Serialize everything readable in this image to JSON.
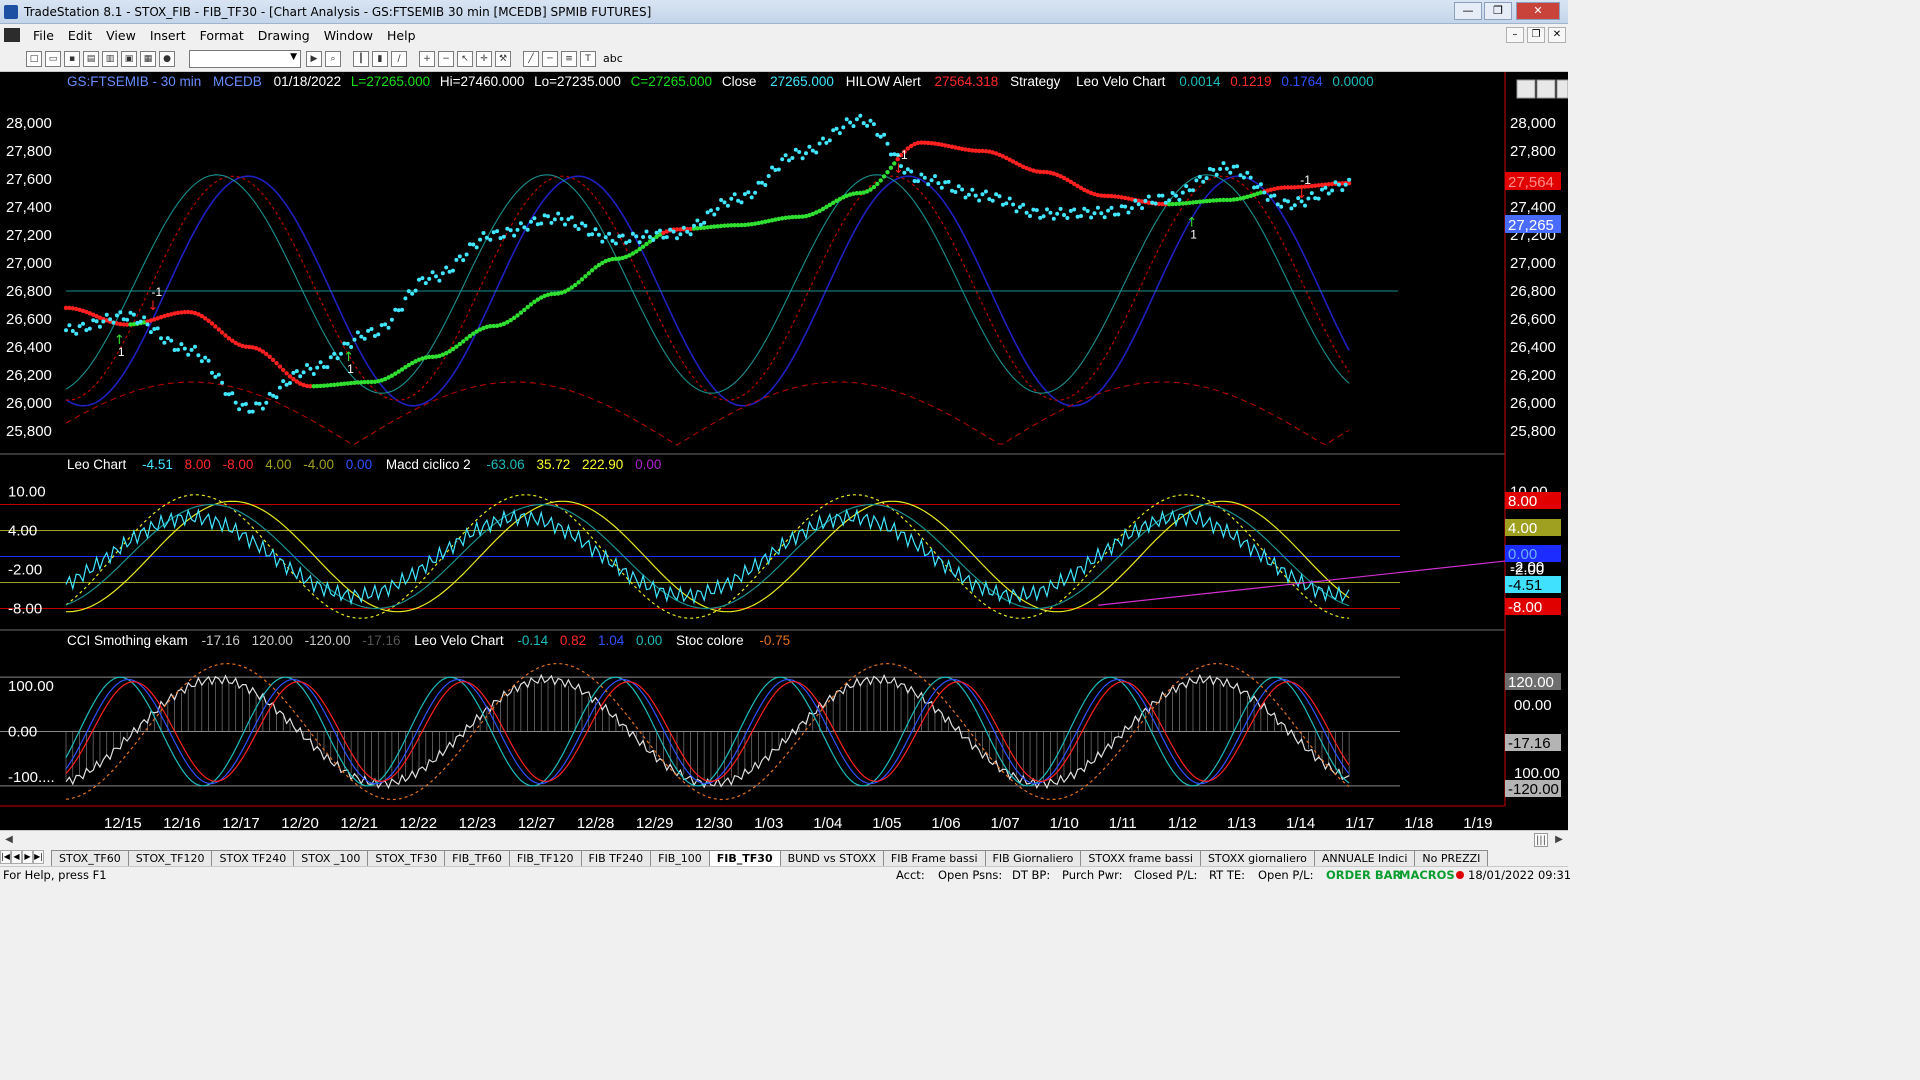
{
  "window": {
    "title": "TradeStation 8.1 - STOX_FIB - FIB_TF30 - [Chart Analysis - GS:FTSEMIB  30 min  [MCEDB] SPMIB FUTURES]",
    "minimize": "—",
    "maximize": "❐",
    "close": "✕"
  },
  "menu": [
    "File",
    "Edit",
    "View",
    "Insert",
    "Format",
    "Drawing",
    "Window",
    "Help"
  ],
  "mdi": {
    "minimize": "–",
    "restore": "❐",
    "close": "✕"
  },
  "toolbar_icons": [
    "new-icon",
    "open-icon",
    "save-icon",
    "print-icon",
    "print-preview-icon",
    "lock-icon",
    "chart-icon",
    "color-icon",
    "sep",
    "symbol-combo",
    "arrow-right-icon",
    "search-icon",
    "sep",
    "bar-icon",
    "candle-icon",
    "line-icon",
    "sep",
    "zoom-in-icon",
    "zoom-out-icon",
    "cursor-icon",
    "crosshair-icon",
    "wrench-icon",
    "sep",
    "trendline-icon",
    "horizontal-line-icon",
    "fib-icon",
    "text-icon"
  ],
  "status_text": {
    "abc": "abc"
  },
  "header": {
    "symbol": "GS:FTSEMIB - 30 min",
    "feed": "MCEDB",
    "date": "01/18/2022",
    "last": "L=27265.000",
    "hi": "Hi=27460.000",
    "lo": "Lo=27235.000",
    "close": "C=27265.000",
    "close_label": "Close",
    "close_value": "27265.000",
    "hilow_label": "HILOW Alert",
    "hilow_value": "27564.318",
    "strategy": "Strategy",
    "velo_label": "Leo Velo Chart",
    "velo_v1": "0.0014",
    "velo_v2": "0.1219",
    "velo_v3": "0.1764",
    "velo_v4": "0.0000"
  },
  "pane2_header": {
    "label": "Leo Chart",
    "v1": "-4.51",
    "v2": "8.00",
    "v3": "-8.00",
    "v4": "4.00",
    "v5": "-4.00",
    "v6": "0.00",
    "macd_label": "Macd ciclico 2",
    "m1": "-63.06",
    "m2": "35.72",
    "m3": "222.90",
    "m4": "0.00"
  },
  "pane3_header": {
    "label": "CCI Smothing ekam",
    "c1": "-17.16",
    "c2": "120.00",
    "c3": "-120.00",
    "c4": "-17.16",
    "velo_label": "Leo Velo Chart",
    "v1": "-0.14",
    "v2": "0.82",
    "v3": "1.04",
    "v4": "0.00",
    "stoc_label": "Stoc colore",
    "s1": "-0.75"
  },
  "price_axis": [
    "28,000",
    "27,800",
    "27,600",
    "27,400",
    "27,200",
    "27,000",
    "26,800",
    "26,600",
    "26,400",
    "26,200",
    "26,000",
    "25,800"
  ],
  "price_tags": {
    "hilow": "27,564",
    "last": "27,265"
  },
  "pane2_axis": [
    "10.00",
    "4.00",
    "-2.00",
    "-8.00"
  ],
  "pane2_tags": {
    "t1": "8.00",
    "t2": "4.00",
    "t3": "0.00",
    "t4": "-2.00",
    "t5": "-4.51",
    "t6": "-8.00"
  },
  "pane3_axis": [
    "100.00",
    "0.00",
    "-100...."
  ],
  "pane3_tags": {
    "t1": "120.00",
    "t2": "00.00",
    "t3": "-17.16",
    "t4": "100.00",
    "t5": "-120.00"
  },
  "date_axis": [
    "12/15",
    "12/16",
    "12/17",
    "12/20",
    "12/21",
    "12/22",
    "12/23",
    "12/27",
    "12/28",
    "12/29",
    "12/30",
    "1/03",
    "1/04",
    "1/05",
    "1/06",
    "1/07",
    "1/10",
    "1/11",
    "1/12",
    "1/13",
    "1/14",
    "1/17",
    "1/18",
    "1/19"
  ],
  "trade_labels": {
    "up": "1",
    "down": "-1"
  },
  "chart_data": {
    "type": "line",
    "title": "GS:FTSEMIB - 30 min",
    "x": [
      "12/15",
      "12/16",
      "12/17",
      "12/20",
      "12/21",
      "12/22",
      "12/23",
      "12/27",
      "12/28",
      "12/29",
      "12/30",
      "1/03",
      "1/04",
      "1/05",
      "1/06",
      "1/07",
      "1/10",
      "1/11",
      "1/12",
      "1/13",
      "1/14",
      "1/17"
    ],
    "price_ylim": [
      25650,
      28150
    ],
    "series": [
      {
        "name": "Close",
        "values": [
          26520,
          26620,
          26380,
          25960,
          26240,
          26500,
          26900,
          27200,
          27320,
          27170,
          27210,
          27460,
          27780,
          28020,
          27600,
          27480,
          27350,
          27360,
          27460,
          27680,
          27420,
          27560
        ]
      },
      {
        "name": "HILOW Alert",
        "values": [
          26680,
          26560,
          26650,
          26400,
          26120,
          26150,
          26330,
          26550,
          26780,
          27030,
          27240,
          27270,
          27330,
          27500,
          27860,
          27800,
          27650,
          27480,
          27420,
          27450,
          27540,
          27570
        ]
      }
    ],
    "pane2_ylim": [
      -11,
      13
    ],
    "pane2_levels": [
      8,
      4,
      0,
      -4,
      -8
    ],
    "pane3_ylim": [
      -160,
      180
    ],
    "pane3_levels": [
      120,
      0,
      -120
    ],
    "grid": false,
    "legend": "top-left"
  },
  "workspace_tabs": [
    "STOX_TF60",
    "STOX_TF120",
    "STOX TF240",
    "STOX _100",
    "STOX_TF30",
    "FIB_TF60",
    "FIB_TF120",
    "FIB TF240",
    "FIB_100",
    "FIB_TF30",
    "BUND vs STOXX",
    "FIB Frame bassi",
    "FIB Giornaliero",
    "STOXX frame bassi",
    "STOXX giornaliero",
    "ANNUALE Indici",
    "No PREZZI"
  ],
  "active_tab": "FIB_TF30",
  "statusbar": {
    "help": "For Help, press F1",
    "acct": "Acct:",
    "open_psns": "Open Psns:",
    "dt_bp": "DT BP:",
    "purch_pwr": "Purch Pwr:",
    "closed_pl": "Closed P/L:",
    "rt_te": "RT TE:",
    "open_pl": "Open P/L:",
    "order_bar": "ORDER BAR",
    "macros": "MACROS",
    "datetime": "18/01/2022 09:31"
  }
}
